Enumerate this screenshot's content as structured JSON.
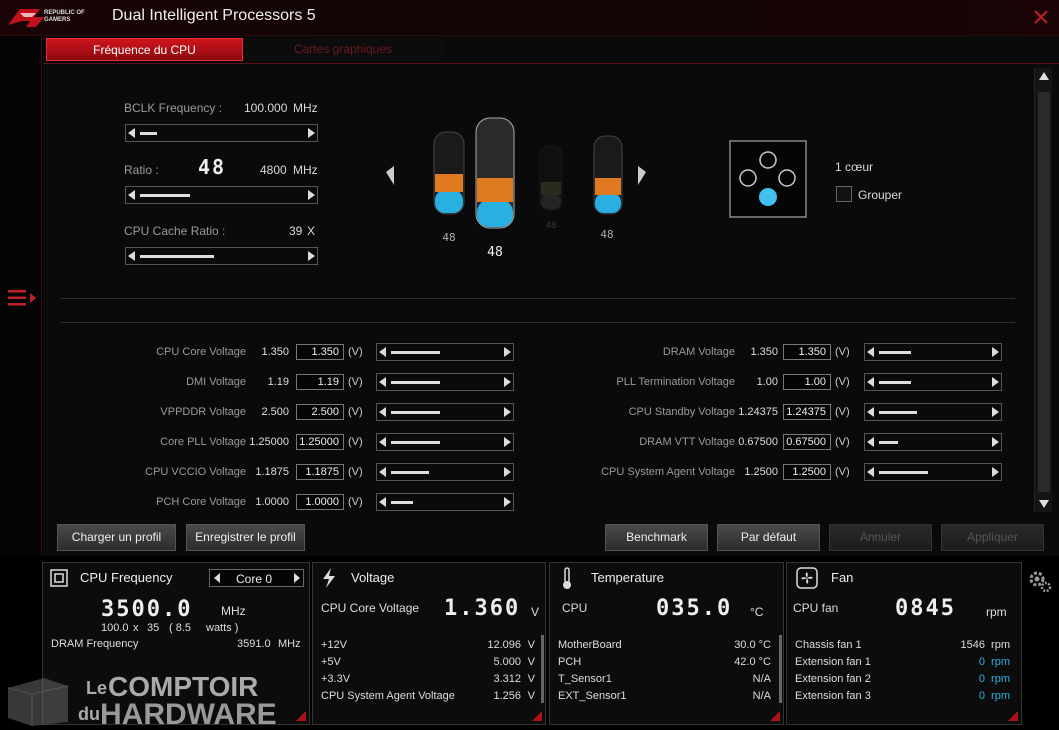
{
  "window": {
    "logo_line1": "REPUBLIC OF",
    "logo_line2": "GAMERS",
    "title": "Dual Intelligent Processors 5"
  },
  "tabs": [
    {
      "label": "Fréquence du CPU",
      "active": true
    },
    {
      "label": "Cartes graphiques",
      "active": false
    }
  ],
  "cpu": {
    "bclk_label": "BCLK Frequency :",
    "bclk_value": "100.000",
    "bclk_unit": "MHz",
    "bclk_slider": 0.1,
    "ratio_label": "Ratio :",
    "ratio_value": "48",
    "ratio_freq": "4800",
    "ratio_unit": "MHz",
    "ratio_slider": 0.3,
    "cache_label": "CPU Cache Ratio :",
    "cache_value": "39",
    "cache_unit": "X",
    "cache_slider": 0.45
  },
  "cores": [
    {
      "label": "48",
      "level": 0.6
    },
    {
      "label": "48",
      "level": 0.6
    },
    {
      "label": "48",
      "level": 0.6
    },
    {
      "label": "48",
      "level": 0.6
    }
  ],
  "core_mode": {
    "count_label": "1 cœur",
    "group_label": "Grouper",
    "group_checked": false
  },
  "voltages_left": [
    {
      "label": "CPU Core Voltage",
      "current": "1.350",
      "input": "1.350",
      "unit": "(V)",
      "level": 0.45
    },
    {
      "label": "DMI Voltage",
      "current": "1.19",
      "input": "1.19",
      "unit": "(V)",
      "level": 0.45
    },
    {
      "label": "VPPDDR Voltage",
      "current": "2.500",
      "input": "2.500",
      "unit": "(V)",
      "level": 0.45
    },
    {
      "label": "Core PLL Voltage",
      "current": "1.25000",
      "input": "1.25000",
      "unit": "(V)",
      "level": 0.45
    },
    {
      "label": "CPU VCCIO Voltage",
      "current": "1.1875",
      "input": "1.1875",
      "unit": "(V)",
      "level": 0.35
    },
    {
      "label": "PCH Core Voltage",
      "current": "1.0000",
      "input": "1.0000",
      "unit": "(V)",
      "level": 0.2
    }
  ],
  "voltages_right": [
    {
      "label": "DRAM Voltage",
      "current": "1.350",
      "input": "1.350",
      "unit": "(V)",
      "level": 0.3
    },
    {
      "label": "PLL Termination Voltage",
      "current": "1.00",
      "input": "1.00",
      "unit": "(V)",
      "level": 0.3
    },
    {
      "label": "CPU Standby Voltage",
      "current": "1.24375",
      "input": "1.24375",
      "unit": "(V)",
      "level": 0.35
    },
    {
      "label": "DRAM VTT Voltage",
      "current": "0.67500",
      "input": "0.67500",
      "unit": "(V)",
      "level": 0.18
    },
    {
      "label": "CPU System Agent Voltage",
      "current": "1.2500",
      "input": "1.2500",
      "unit": "(V)",
      "level": 0.45
    }
  ],
  "buttons": {
    "load_profile": "Charger un profil",
    "save_profile": "Enregistrer le profil",
    "benchmark": "Benchmark",
    "default": "Par défaut",
    "cancel": "Annuler",
    "apply": "Appliquer"
  },
  "monitor": {
    "freq": {
      "title": "CPU Frequency",
      "core_select": "Core 0",
      "value": "3500.0",
      "unit": "MHz",
      "detail_base": "100.0",
      "detail_x": "x",
      "detail_mult": "35",
      "detail_watts": "( 8.5",
      "detail_watts_unit": "watts )",
      "dram_label": "DRAM Frequency",
      "dram_value": "3591.0",
      "dram_unit": "MHz"
    },
    "voltage": {
      "title": "Voltage",
      "main_label": "CPU Core Voltage",
      "main_value": "1.360",
      "main_unit": "V",
      "rows": [
        {
          "label": "+12V",
          "value": "12.096",
          "unit": "V"
        },
        {
          "label": "+5V",
          "value": "5.000",
          "unit": "V"
        },
        {
          "label": "+3.3V",
          "value": "3.312",
          "unit": "V"
        },
        {
          "label": "CPU System Agent Voltage",
          "value": "1.256",
          "unit": "V"
        }
      ]
    },
    "temperature": {
      "title": "Temperature",
      "main_label": "CPU",
      "main_value": "035.0",
      "main_unit": "°C",
      "rows": [
        {
          "label": "MotherBoard",
          "value": "30.0 °C"
        },
        {
          "label": "PCH",
          "value": "42.0 °C"
        },
        {
          "label": "T_Sensor1",
          "value": "N/A"
        },
        {
          "label": "EXT_Sensor1",
          "value": "N/A"
        }
      ]
    },
    "fan": {
      "title": "Fan",
      "main_label": "CPU fan",
      "main_value": "0845",
      "main_unit": "rpm",
      "rows": [
        {
          "label": "Chassis fan 1",
          "value": "1546",
          "unit": "rpm"
        },
        {
          "label": "Extension fan 1",
          "value": "0",
          "unit": "rpm"
        },
        {
          "label": "Extension fan 2",
          "value": "0",
          "unit": "rpm"
        },
        {
          "label": "Extension fan 3",
          "value": "0",
          "unit": "rpm"
        }
      ]
    }
  },
  "watermark": {
    "line1a": "Le",
    "line1b": "COMPTOIR",
    "line2a": "du",
    "line2b": "HARDWARE"
  },
  "colors": {
    "accent_red": "#d0141c",
    "cyan": "#2ab0e0",
    "orange": "#e07a20",
    "fan_value_cyan": "#2ab0e0"
  }
}
